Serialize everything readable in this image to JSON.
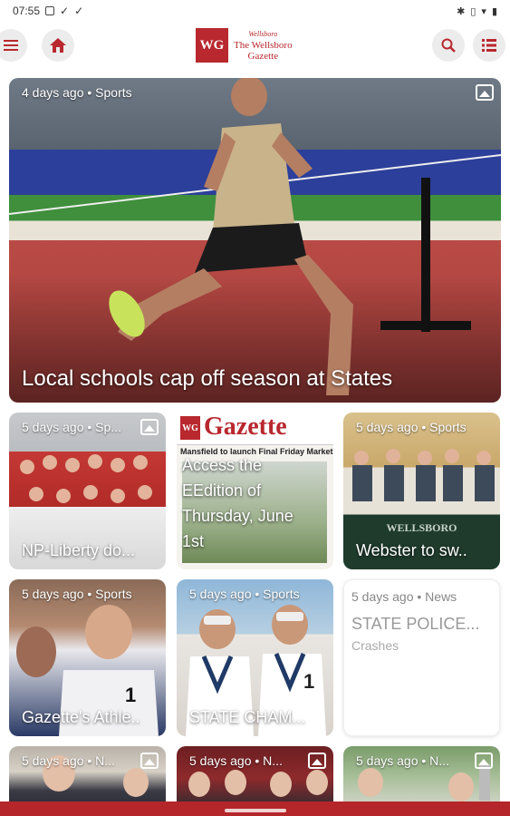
{
  "status_bar": {
    "time": "07:55"
  },
  "header": {
    "menu_icon": "hamburger-icon",
    "home_icon": "home-icon",
    "search_icon": "search-icon",
    "list_icon": "list-icon",
    "logo_initials": "WG",
    "logo_small": "Wellsboro",
    "logo_line1": "The Wellsboro",
    "logo_line2": "Gazette"
  },
  "colors": {
    "brand": "#b8282e"
  },
  "hero": {
    "meta": "4 days ago • Sports",
    "headline": "Local schools cap off season at States"
  },
  "cards": [
    {
      "meta": "5 days ago • Sp...",
      "headline": "NP-Liberty do...",
      "has_image_badge": true
    },
    {
      "masthead": "Gazette",
      "masthead_brand": "WG",
      "strap": "Mansfield to launch Final Friday Markets",
      "headline_lines": [
        "Access the",
        "EEdition of",
        "Thursday, June",
        "1st"
      ]
    },
    {
      "meta": "5 days ago • Sports",
      "headline": "Webster to sw..",
      "sign": "WELLSBORO"
    },
    {
      "meta": "5 days ago • Sports",
      "headline": "Gazette's Athle..",
      "jersey": "1"
    },
    {
      "meta": "5 days ago • Sports",
      "headline": "STATE CHAM...",
      "jersey": "1"
    },
    {
      "meta": "5 days ago • News",
      "title": "STATE POLICE...",
      "subtitle": "Crashes"
    },
    {
      "meta": "5 days ago • N...",
      "has_image_badge": true
    },
    {
      "meta": "5 days ago • N...",
      "has_image_badge": true
    },
    {
      "meta": "5 days ago • N...",
      "has_image_badge": true
    }
  ]
}
